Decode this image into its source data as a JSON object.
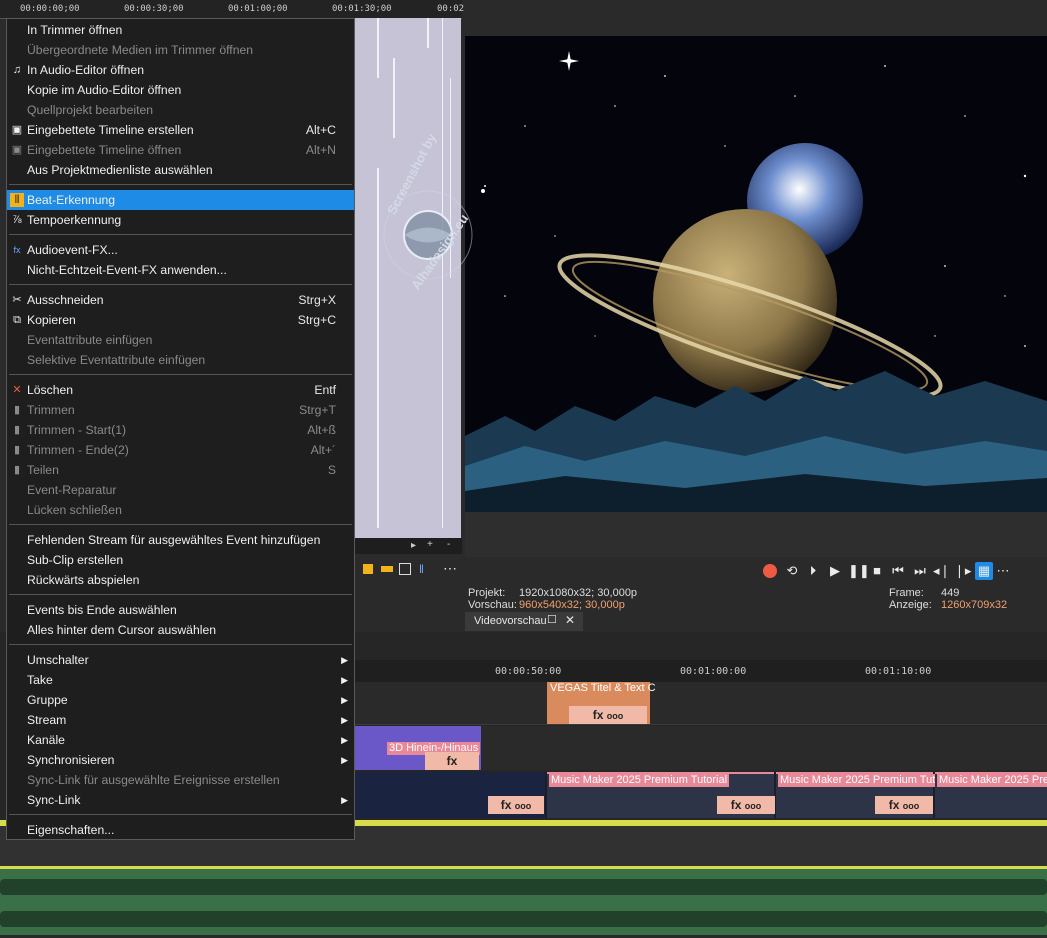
{
  "trimmer": {
    "ruler_ticks": [
      "00:00:00;00",
      "00:00:30;00",
      "00:01:00;00",
      "00:01:30;00",
      "00:02"
    ]
  },
  "menu": {
    "items": [
      {
        "label": "In Trimmer öffnen",
        "shortcut": "",
        "disabled": false,
        "icon": "",
        "submenu": false
      },
      {
        "label": "Übergeordnete Medien im Trimmer öffnen",
        "shortcut": "",
        "disabled": true,
        "icon": "",
        "submenu": false
      },
      {
        "label": "In Audio-Editor öffnen",
        "shortcut": "",
        "disabled": false,
        "icon": "audio-editor-icon",
        "submenu": false
      },
      {
        "label": "Kopie im Audio-Editor öffnen",
        "shortcut": "",
        "disabled": false,
        "icon": "",
        "submenu": false
      },
      {
        "label": "Quellprojekt bearbeiten",
        "shortcut": "",
        "disabled": true,
        "icon": "",
        "submenu": false
      },
      {
        "label": "Eingebettete Timeline erstellen",
        "shortcut": "Alt+C",
        "disabled": false,
        "icon": "nested-timeline-icon",
        "submenu": false
      },
      {
        "label": "Eingebettete Timeline öffnen",
        "shortcut": "Alt+N",
        "disabled": true,
        "icon": "nested-timeline-open-icon",
        "submenu": false
      },
      {
        "label": "Aus Projektmedienliste auswählen",
        "shortcut": "",
        "disabled": false,
        "icon": "",
        "submenu": false
      },
      {
        "label": "Beat-Erkennung",
        "shortcut": "",
        "disabled": false,
        "icon": "beat-detection-icon",
        "submenu": false,
        "highlighted": true
      },
      {
        "label": "Tempoerkennung",
        "shortcut": "",
        "disabled": false,
        "icon": "tempo-icon",
        "submenu": false
      },
      {
        "label": "Audioevent-FX...",
        "shortcut": "",
        "disabled": false,
        "icon": "fx-icon",
        "submenu": false
      },
      {
        "label": "Nicht-Echtzeit-Event-FX anwenden...",
        "shortcut": "",
        "disabled": false,
        "icon": "",
        "submenu": false
      },
      {
        "label": "Ausschneiden",
        "shortcut": "Strg+X",
        "disabled": false,
        "icon": "scissors-icon",
        "submenu": false
      },
      {
        "label": "Kopieren",
        "shortcut": "Strg+C",
        "disabled": false,
        "icon": "copy-icon",
        "submenu": false
      },
      {
        "label": "Eventattribute einfügen",
        "shortcut": "",
        "disabled": true,
        "icon": "",
        "submenu": false
      },
      {
        "label": "Selektive Eventattribute einfügen",
        "shortcut": "",
        "disabled": true,
        "icon": "",
        "submenu": false
      },
      {
        "label": "Löschen",
        "shortcut": "Entf",
        "disabled": false,
        "icon": "delete-icon",
        "submenu": false
      },
      {
        "label": "Trimmen",
        "shortcut": "Strg+T",
        "disabled": true,
        "icon": "trim-icon",
        "submenu": false
      },
      {
        "label": "Trimmen - Start(1)",
        "shortcut": "Alt+ß",
        "disabled": true,
        "icon": "trim-start-icon",
        "submenu": false
      },
      {
        "label": "Trimmen - Ende(2)",
        "shortcut": "Alt+´",
        "disabled": true,
        "icon": "trim-end-icon",
        "submenu": false
      },
      {
        "label": "Teilen",
        "shortcut": "S",
        "disabled": true,
        "icon": "split-icon",
        "submenu": false
      },
      {
        "label": "Event-Reparatur",
        "shortcut": "",
        "disabled": true,
        "icon": "",
        "submenu": false
      },
      {
        "label": "Lücken schließen",
        "shortcut": "",
        "disabled": true,
        "icon": "",
        "submenu": false
      },
      {
        "label": "Fehlenden Stream für ausgewähltes Event hinzufügen",
        "shortcut": "",
        "disabled": false,
        "icon": "",
        "submenu": false
      },
      {
        "label": "Sub-Clip erstellen",
        "shortcut": "",
        "disabled": false,
        "icon": "",
        "submenu": false
      },
      {
        "label": "Rückwärts abspielen",
        "shortcut": "",
        "disabled": false,
        "icon": "",
        "submenu": false
      },
      {
        "label": "Events bis Ende auswählen",
        "shortcut": "",
        "disabled": false,
        "icon": "",
        "submenu": false
      },
      {
        "label": "Alles hinter dem Cursor auswählen",
        "shortcut": "",
        "disabled": false,
        "icon": "",
        "submenu": false
      },
      {
        "label": "Umschalter",
        "shortcut": "",
        "disabled": false,
        "icon": "",
        "submenu": true
      },
      {
        "label": "Take",
        "shortcut": "",
        "disabled": false,
        "icon": "",
        "submenu": true
      },
      {
        "label": "Gruppe",
        "shortcut": "",
        "disabled": false,
        "icon": "",
        "submenu": true
      },
      {
        "label": "Stream",
        "shortcut": "",
        "disabled": false,
        "icon": "",
        "submenu": true
      },
      {
        "label": "Kanäle",
        "shortcut": "",
        "disabled": false,
        "icon": "",
        "submenu": true
      },
      {
        "label": "Synchronisieren",
        "shortcut": "",
        "disabled": false,
        "icon": "",
        "submenu": true
      },
      {
        "label": "Sync-Link für ausgewählte Ereignisse erstellen",
        "shortcut": "",
        "disabled": true,
        "icon": "",
        "submenu": false
      },
      {
        "label": "Sync-Link",
        "shortcut": "",
        "disabled": false,
        "icon": "",
        "submenu": true
      },
      {
        "label": "Eigenschaften...",
        "shortcut": "",
        "disabled": false,
        "icon": "",
        "submenu": false
      }
    ]
  },
  "preview": {
    "project_label": "Projekt:",
    "project_value": "1920x1080x32; 30,000p",
    "preview_label": "Vorschau:",
    "preview_value": "960x540x32; 30,000p",
    "frame_label": "Frame:",
    "frame_value": "449",
    "display_label": "Anzeige:",
    "display_value": "1260x709x32",
    "tab_label": "Videovorschau"
  },
  "timeline": {
    "ruler_ticks": [
      "00:00:50:00",
      "00:01:00:00",
      "00:01:10:00"
    ],
    "events": {
      "title_event": "VEGAS Titel & Text C",
      "intro_event": "3D Hinein-/Hinaus",
      "clip_1": "Music Maker 2025 Premium Tutorial",
      "clip_2": "Music Maker 2025 Premium Tuto",
      "clip_3": "Music Maker 2025 Premi"
    },
    "fx_label": "fx",
    "more_label": "ooo"
  },
  "watermark": {
    "text_top": "Screenshot by",
    "text_bottom": "Alhadesign.eu"
  },
  "colors": {
    "menu_highlight": "#1e8ce6",
    "audio_track": "#3a7048",
    "record": "#f05a45"
  }
}
